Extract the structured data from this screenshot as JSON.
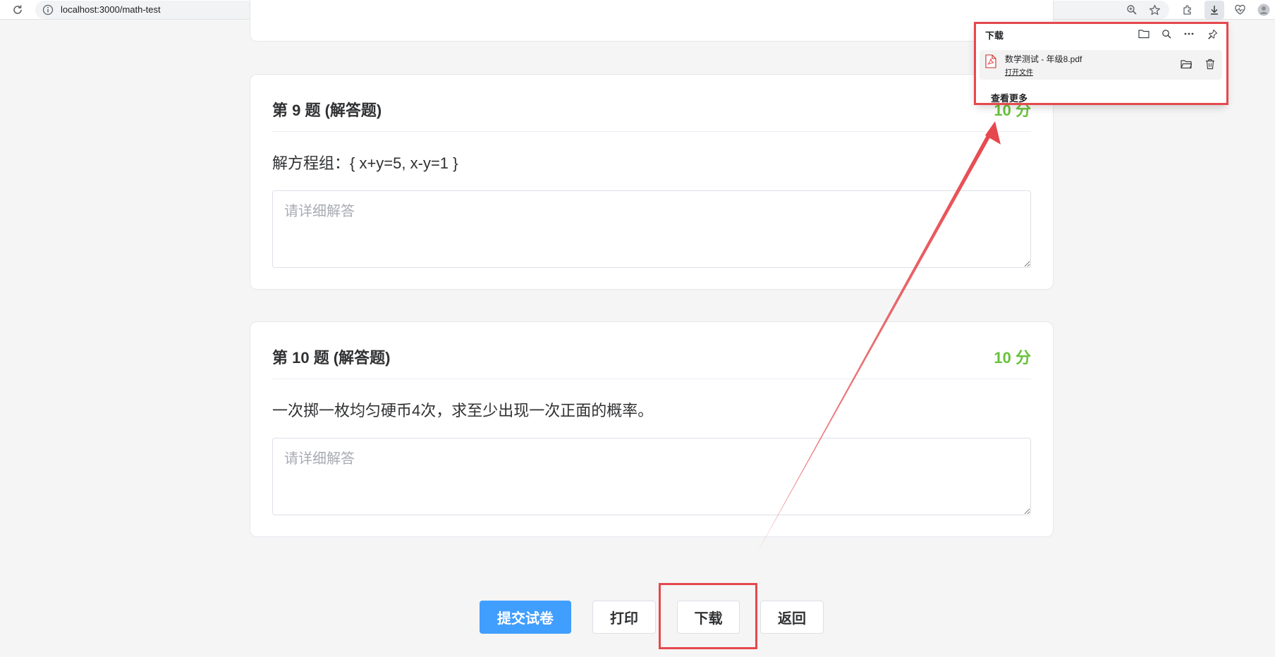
{
  "browser": {
    "url": "localhost:3000/math-test",
    "icons": {
      "reload": "reload-icon",
      "site_info": "info-icon",
      "zoom": "zoom-icon",
      "bookmark": "star-icon",
      "extensions": "puzzle-icon",
      "downloads": "download-icon",
      "health": "heartbeat-icon",
      "profile": "avatar-icon"
    }
  },
  "downloads_panel": {
    "title": "下载",
    "item": {
      "filename": "数学测试 - 年级8.pdf",
      "open_label": "打开文件",
      "file_icon": "pdf-file-icon"
    },
    "see_more_label": "查看更多",
    "icons": {
      "open_folder": "folder-icon",
      "search": "search-icon",
      "more": "more-icon",
      "pin": "pin-icon",
      "item_folder": "folder-icon",
      "item_delete": "trash-icon"
    }
  },
  "questions": [
    {
      "title": "第 9 题 (解答题)",
      "score": "10 分",
      "text": "解方程组：{ x+y=5, x-y=1 }",
      "answer_placeholder": "请详细解答"
    },
    {
      "title": "第 10 题 (解答题)",
      "score": "10 分",
      "text": "一次掷一枚均匀硬币4次，求至少出现一次正面的概率。",
      "answer_placeholder": "请详细解答"
    }
  ],
  "actions": {
    "submit": "提交试卷",
    "print": "打印",
    "download": "下载",
    "back": "返回"
  },
  "colors": {
    "primary": "#409eff",
    "score": "#67c23a",
    "annotation": "#e5484d",
    "page_background": "#f5f5f5"
  }
}
